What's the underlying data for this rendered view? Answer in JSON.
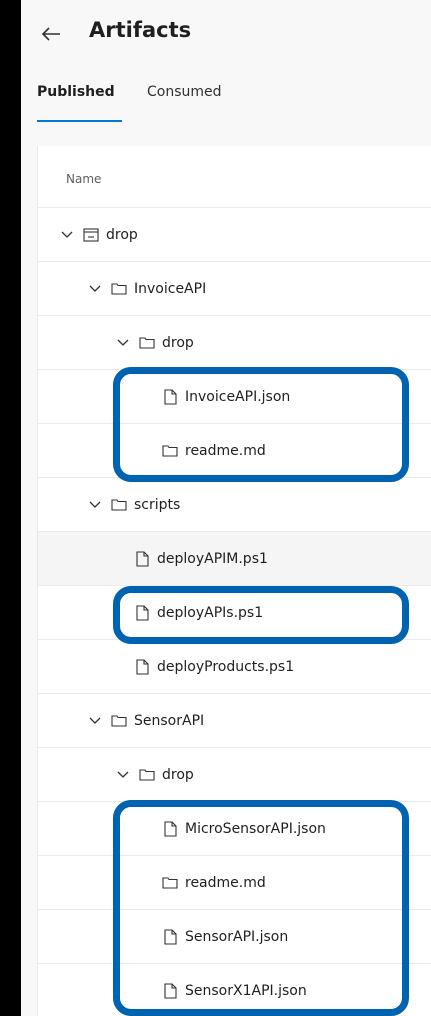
{
  "header": {
    "title": "Artifacts"
  },
  "tabs": {
    "published": "Published",
    "consumed": "Consumed"
  },
  "table": {
    "column_name": "Name"
  },
  "tree": [
    {
      "label": "drop",
      "type": "artifact",
      "expanded": true
    },
    {
      "label": "InvoiceAPI",
      "type": "folder",
      "expanded": true
    },
    {
      "label": "drop",
      "type": "folder",
      "expanded": true
    },
    {
      "label": "InvoiceAPI.json",
      "type": "file"
    },
    {
      "label": "readme.md",
      "type": "folder-file"
    },
    {
      "label": "scripts",
      "type": "folder",
      "expanded": true
    },
    {
      "label": "deployAPIM.ps1",
      "type": "file"
    },
    {
      "label": "deployAPIs.ps1",
      "type": "file"
    },
    {
      "label": "deployProducts.ps1",
      "type": "file"
    },
    {
      "label": "SensorAPI",
      "type": "folder",
      "expanded": true
    },
    {
      "label": "drop",
      "type": "folder",
      "expanded": true
    },
    {
      "label": "MicroSensorAPI.json",
      "type": "file"
    },
    {
      "label": "readme.md",
      "type": "folder-file"
    },
    {
      "label": "SensorAPI.json",
      "type": "file"
    },
    {
      "label": "SensorX1API.json",
      "type": "file"
    }
  ],
  "colors": {
    "accent": "#0078d4",
    "highlight": "#0063b1"
  }
}
